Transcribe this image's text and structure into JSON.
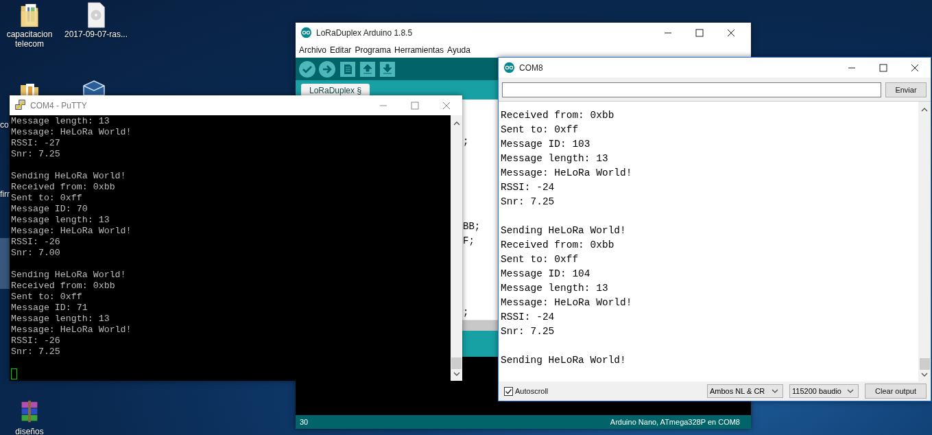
{
  "desktop": {
    "icons": [
      {
        "kind": "folder-docs",
        "label": "capacitacion telecom"
      },
      {
        "kind": "disc-file",
        "label": "2017-09-07-ras..."
      },
      {
        "kind": "rar",
        "label": "diseños"
      }
    ],
    "fragments": [
      "co",
      "firr"
    ]
  },
  "arduino": {
    "title": "LoRaDuplex Arduino 1.8.5",
    "menu": [
      "Archivo",
      "Editar",
      "Programa",
      "Herramientas",
      "Ayuda"
    ],
    "tab": "LoRaDuplex §",
    "code_lines": [
      {
        "kind": "blank"
      },
      {
        "kind": "blank"
      },
      {
        "kind": "code",
        "text": ";"
      },
      {
        "kind": "blank"
      },
      {
        "kind": "blank"
      },
      {
        "kind": "blank"
      },
      {
        "kind": "blank"
      },
      {
        "kind": "blank"
      },
      {
        "kind": "code",
        "text": "BB;"
      },
      {
        "kind": "code",
        "text": "F;"
      },
      {
        "kind": "blank"
      },
      {
        "kind": "blank"
      },
      {
        "kind": "blank"
      },
      {
        "kind": "blank"
      },
      {
        "kind": "code",
        "text": ";"
      }
    ],
    "line_number": "30",
    "board": "Arduino Nano, ATmega328P en COM8"
  },
  "putty": {
    "title": "COM4 - PuTTY",
    "blocks": [
      [
        "Message length: 13",
        "Message: HeLoRa World!",
        "RSSI: -27",
        "Snr: 7.25"
      ],
      [
        "Sending HeLoRa World!",
        "Received from: 0xbb",
        "Sent to: 0xff",
        "Message ID: 70",
        "Message length: 13",
        "Message: HeLoRa World!",
        "RSSI: -26",
        "Snr: 7.00"
      ],
      [
        "Sending HeLoRa World!",
        "Received from: 0xbb",
        "Sent to: 0xff",
        "Message ID: 71",
        "Message length: 13",
        "Message: HeLoRa World!",
        "RSSI: -26",
        "Snr: 7.25"
      ]
    ]
  },
  "serial_monitor": {
    "title": "COM8",
    "send_button": "Enviar",
    "blocks": [
      [
        "Received from: 0xbb",
        "Sent to: 0xff",
        "Message ID: 103",
        "Message length: 13",
        "Message: HeLoRa World!",
        "RSSI: -24",
        "Snr: 7.25"
      ],
      [
        "Sending HeLoRa World!",
        "Received from: 0xbb",
        "Sent to: 0xff",
        "Message ID: 104",
        "Message length: 13",
        "Message: HeLoRa World!",
        "RSSI: -24",
        "Snr: 7.25"
      ],
      [
        "Sending HeLoRa World!"
      ]
    ],
    "autoscroll": {
      "label": "Autoscroll",
      "checked": true
    },
    "line_ending": "Ambos NL & CR",
    "baud": "115200 baudio",
    "clear_button": "Clear output"
  }
}
